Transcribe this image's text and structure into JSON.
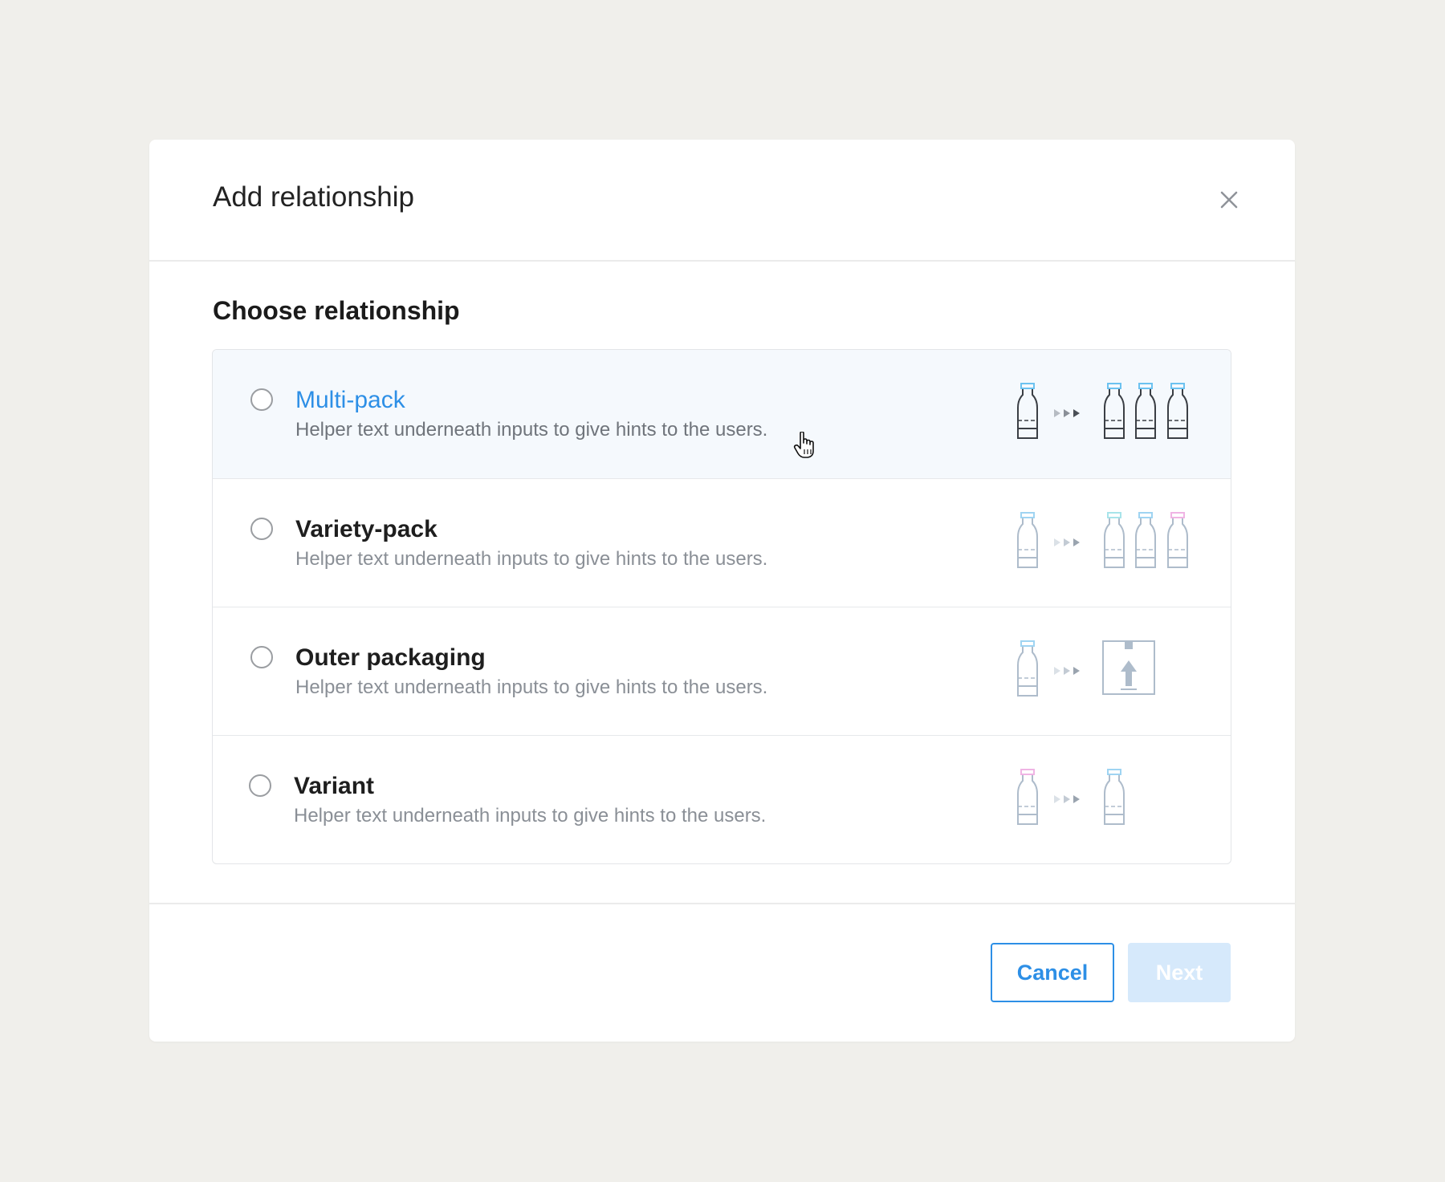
{
  "dialog": {
    "title": "Add relationship",
    "close_icon": "close-icon"
  },
  "section_label": "Choose relationship",
  "options": [
    {
      "title": "Multi-pack",
      "helper": "Helper text underneath inputs to give hints to the users.",
      "state": "hovered",
      "illustration": "single-bottle-to-three-bottles"
    },
    {
      "title": "Variety-pack",
      "helper": "Helper text underneath inputs to give hints to the users.",
      "illustration": "single-bottle-to-three-varied-bottles"
    },
    {
      "title": "Outer packaging",
      "helper": "Helper text underneath inputs to give hints to the users.",
      "illustration": "bottle-to-box"
    },
    {
      "title": "Variant",
      "helper": "Helper text underneath inputs to give hints to the users.",
      "illustration": "bottle-to-bottle"
    }
  ],
  "footer": {
    "cancel_label": "Cancel",
    "next_label": "Next",
    "next_disabled": true
  },
  "colors": {
    "accent": "#2d8fe6",
    "hover_bg": "#f5f9fd",
    "disabled_button_bg": "#d6e9fb",
    "page_bg": "#f0efeb"
  }
}
